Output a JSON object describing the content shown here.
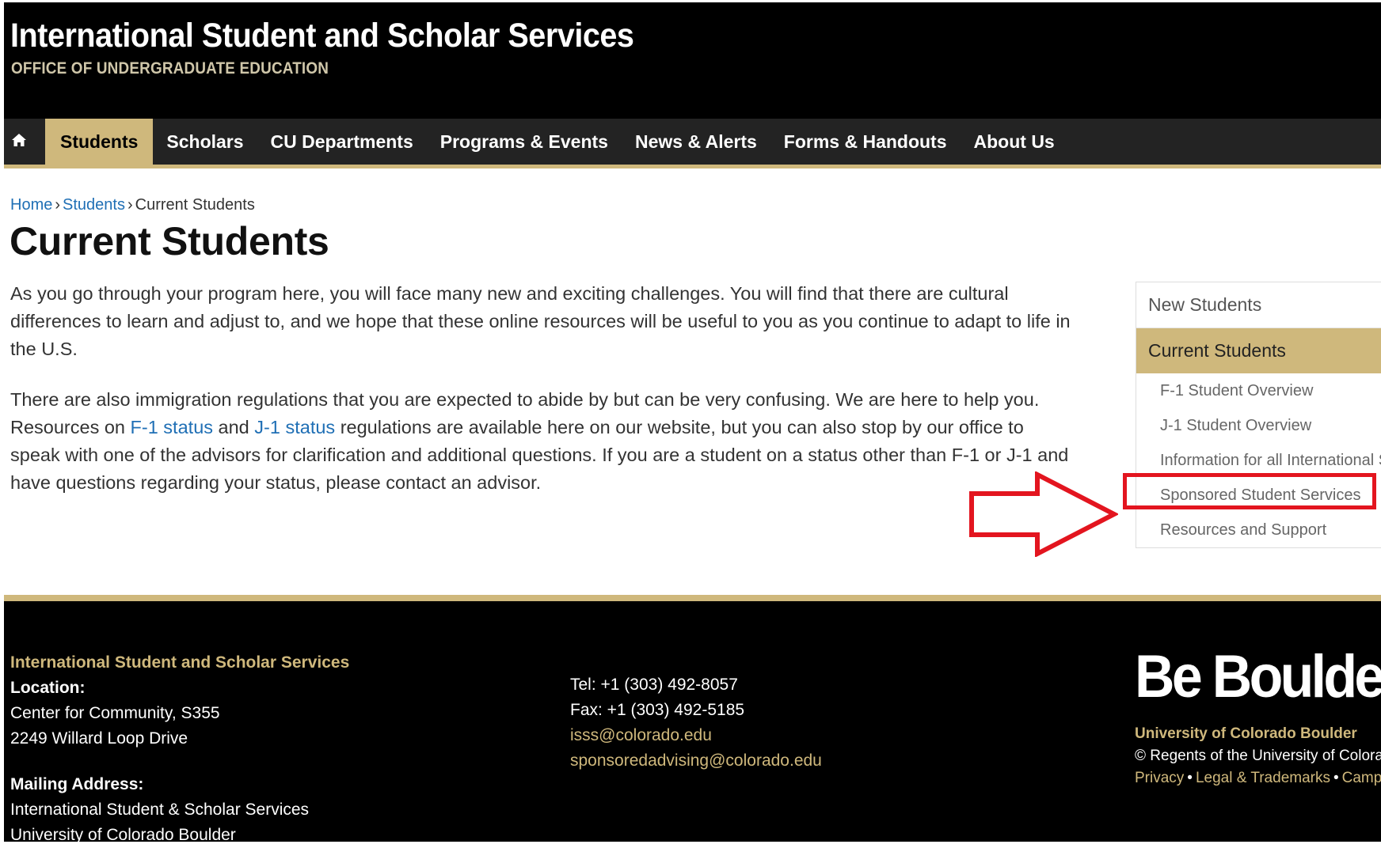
{
  "header": {
    "title": "International Student and Scholar Services",
    "subtitle": "OFFICE OF UNDERGRADUATE EDUCATION"
  },
  "nav": {
    "home_icon": "home-icon",
    "items": [
      {
        "label": "Students",
        "active": true
      },
      {
        "label": "Scholars"
      },
      {
        "label": "CU Departments"
      },
      {
        "label": "Programs & Events"
      },
      {
        "label": "News & Alerts"
      },
      {
        "label": "Forms & Handouts"
      },
      {
        "label": "About Us"
      }
    ]
  },
  "breadcrumb": {
    "items": [
      "Home",
      "Students",
      "Current Students"
    ],
    "separator": "›"
  },
  "page": {
    "title": "Current Students",
    "p1": "As you go through your program here, you will face many new and exciting challenges. You will find that there are cultural differences to learn and adjust to, and we hope that these online resources will be useful to you as you continue to adapt to life in the U.S.",
    "p2_a": "There are also immigration regulations that you are expected to abide by but can be very confusing. We are here to help you. Resources on ",
    "p2_link1": "F-1 status",
    "p2_b": " and ",
    "p2_link2": "J-1 status",
    "p2_c": " regulations are available here on our website, but you can also stop by our office to speak with one of the advisors for clarification and additional questions. If you are a student on a status other than F-1 or J-1 and have questions regarding your status, please contact an advisor."
  },
  "side_menu": {
    "top": "New Students",
    "current": "Current Students",
    "sub_items": [
      "F-1 Student Overview",
      "J-1 Student Overview",
      "Information for all International Students",
      "Sponsored Student Services",
      "Resources and Support"
    ]
  },
  "annotation": {
    "color": "#e3151f",
    "target": "Sponsored Student Services"
  },
  "footer": {
    "org_name": "International Student and Scholar Services",
    "location_label": "Location:",
    "location_line1": "Center for Community, S355",
    "location_line2": "2249 Willard Loop Drive",
    "mailing_label": "Mailing Address:",
    "mailing_line1": "International Student & Scholar Services",
    "mailing_line2": "University of Colorado Boulder",
    "tel": "Tel: +1 (303) 492-8057",
    "fax": "Fax: +1 (303) 492-5185",
    "email1": "isss@colorado.edu",
    "email2": "sponsoredadvising@colorado.edu",
    "brand": "Be Boulder.",
    "university": "University of Colorado Boulder",
    "regents": "© Regents of the University of Colorado",
    "links": [
      "Privacy",
      "Legal & Trademarks",
      "Campus Map"
    ]
  },
  "colors": {
    "gold": "#cfb87c",
    "black": "#000000",
    "link_blue": "#1f6fb5"
  }
}
